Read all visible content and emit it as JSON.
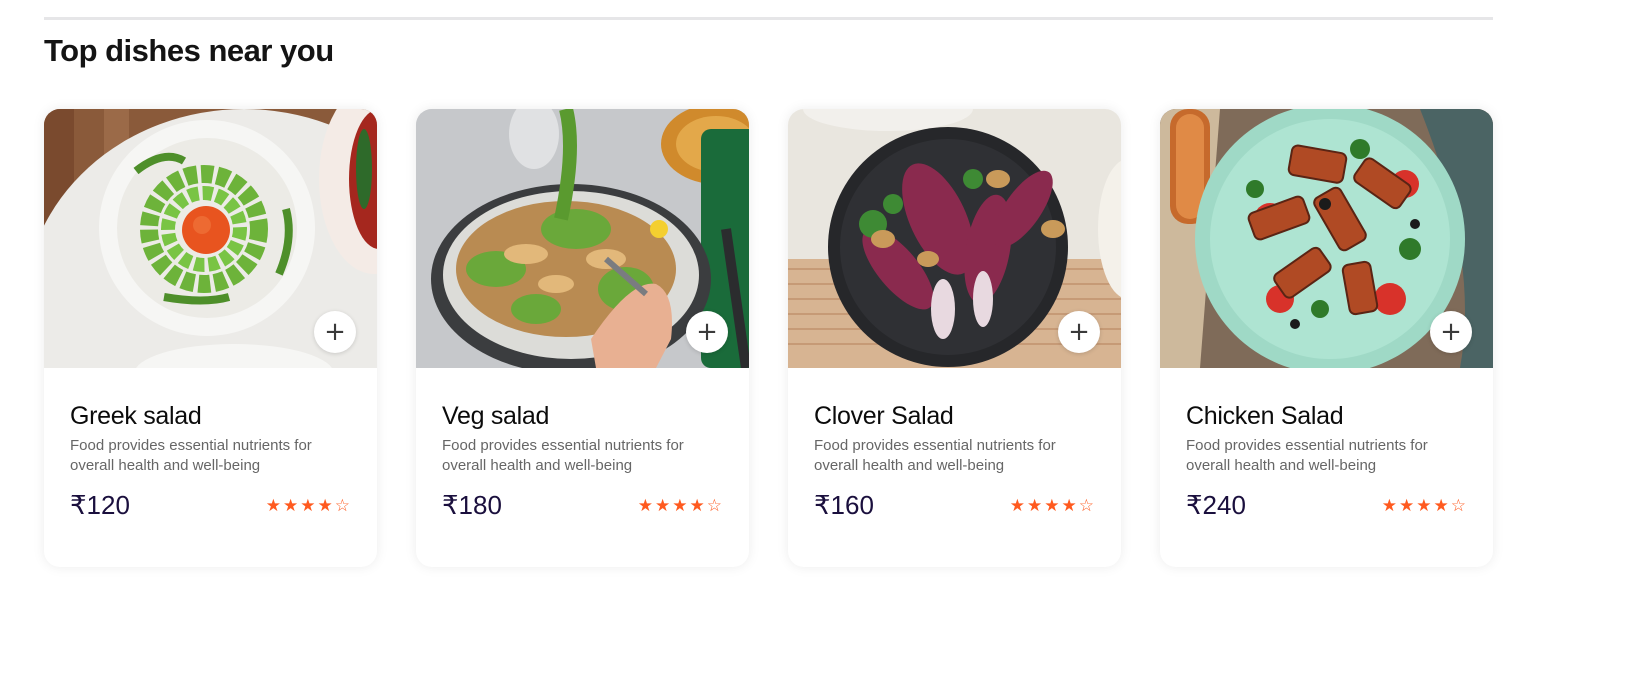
{
  "section": {
    "title": "Top dishes near you"
  },
  "colors": {
    "accent_star": "#ff5a1f",
    "price": "#1a0f3d",
    "divider": "#e6e6e8"
  },
  "add_button_symbol": "+",
  "dishes": [
    {
      "name": "Greek salad",
      "description": "Food provides essential nutrients for overall health and well-being",
      "price": "₹120",
      "rating": 4,
      "rating_max": 5,
      "image": "greek-salad-photo"
    },
    {
      "name": "Veg salad",
      "description": "Food provides essential nutrients for overall health and well-being",
      "price": "₹180",
      "rating": 4,
      "rating_max": 5,
      "image": "veg-salad-photo"
    },
    {
      "name": "Clover Salad",
      "description": "Food provides essential nutrients for overall health and well-being",
      "price": "₹160",
      "rating": 4,
      "rating_max": 5,
      "image": "clover-salad-photo"
    },
    {
      "name": "Chicken Salad",
      "description": "Food provides essential nutrients for overall health and well-being",
      "price": "₹240",
      "rating": 4,
      "rating_max": 5,
      "image": "chicken-salad-photo"
    }
  ]
}
